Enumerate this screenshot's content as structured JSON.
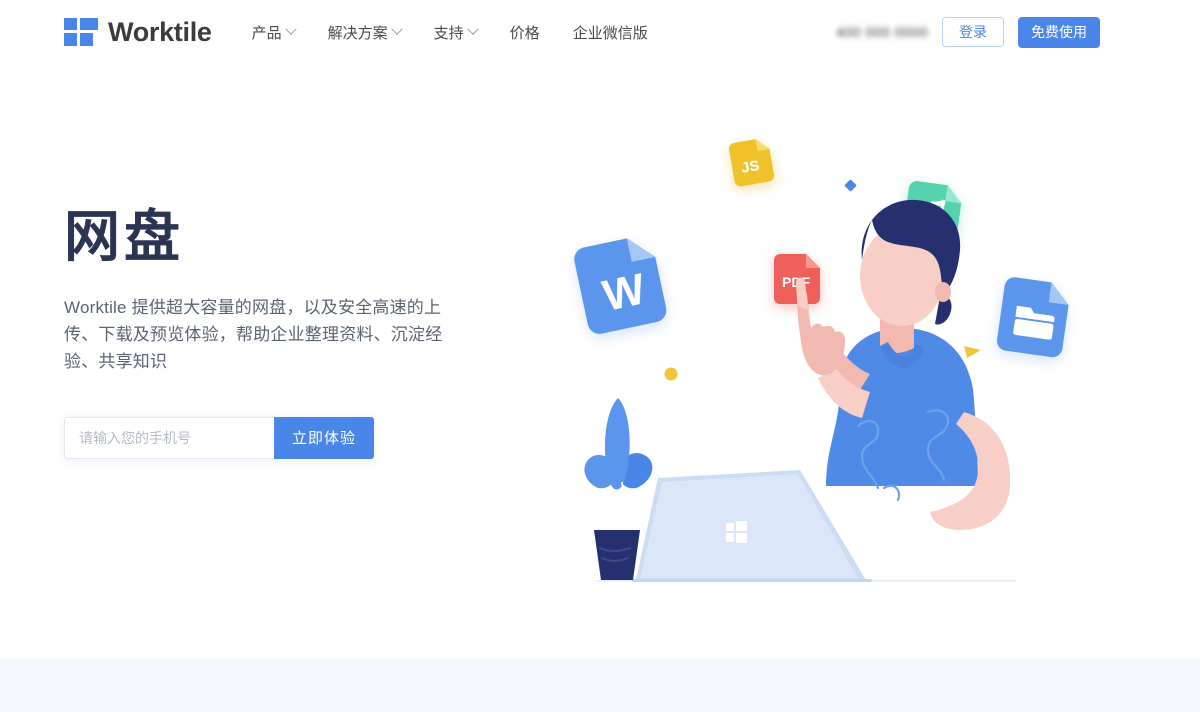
{
  "header": {
    "brand_name": "Worktile",
    "logo_icon": "worktile-grid-logo-icon",
    "nav": [
      {
        "label": "产品",
        "has_caret": true
      },
      {
        "label": "解决方案",
        "has_caret": true
      },
      {
        "label": "支持",
        "has_caret": true
      },
      {
        "label": "价格",
        "has_caret": false
      },
      {
        "label": "企业微信版",
        "has_caret": false
      }
    ],
    "phone": "400 000 0000",
    "phone_visible_prefix": "4",
    "login_label": "登录",
    "free_trial_label": "免费使用"
  },
  "hero": {
    "title": "网盘",
    "description": "Worktile 提供超大容量的网盘，以及安全高速的上传、下载及预览体验，帮助企业整理资料、沉淀经验、共享知识",
    "input_placeholder": "请输入您的手机号",
    "input_value": "",
    "submit_label": "立即体验"
  },
  "illustration": {
    "name": "cloud-drive-hero-illustration",
    "file_cards": [
      {
        "name": "js-file-icon",
        "label": "JS",
        "color": "#efc229"
      },
      {
        "name": "word-file-icon",
        "label": "W",
        "color": "#5b96ec"
      },
      {
        "name": "pdf-file-icon",
        "label": "PDF",
        "color": "#f0615a"
      },
      {
        "name": "music-file-icon",
        "label": "♫",
        "color": "#56d3ae"
      },
      {
        "name": "folder-file-icon",
        "label": "folder",
        "color": "#5b96ec"
      }
    ],
    "person": "man-pointing-up-with-laptop",
    "plant": "potted-plant",
    "laptop": "laptop-with-logo"
  },
  "colors": {
    "accent_blue": "#4a86e8",
    "title_navy": "#2b3553",
    "body_gray": "#5b6472",
    "band_bg": "#f5f8fd"
  }
}
